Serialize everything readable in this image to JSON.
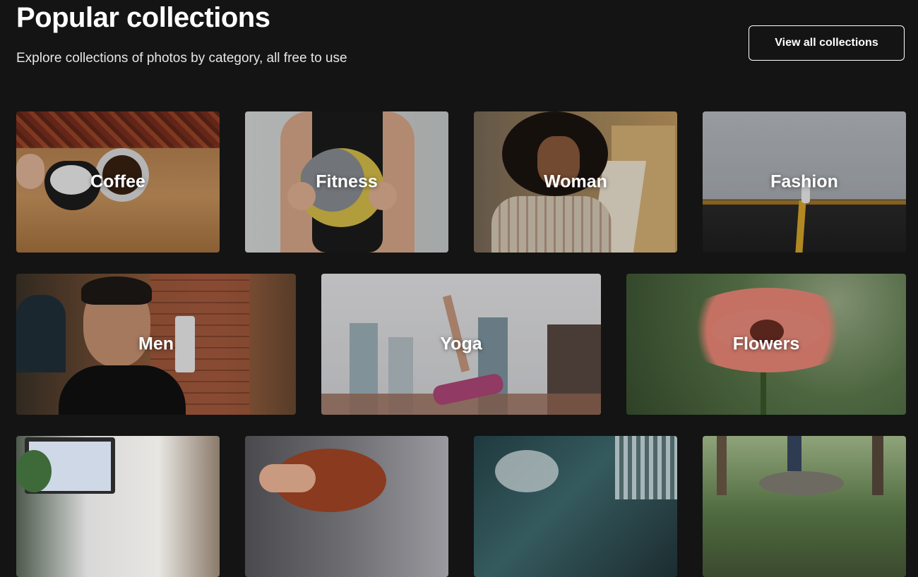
{
  "header": {
    "title": "Popular collections",
    "subtitle": "Explore collections of photos by category, all free to use",
    "view_all_label": "View all collections"
  },
  "collections": [
    {
      "label": "Coffee"
    },
    {
      "label": "Fitness"
    },
    {
      "label": "Woman"
    },
    {
      "label": "Fashion"
    },
    {
      "label": "Men"
    },
    {
      "label": "Yoga"
    },
    {
      "label": "Flowers"
    },
    {
      "label": ""
    },
    {
      "label": ""
    },
    {
      "label": ""
    },
    {
      "label": ""
    }
  ],
  "colors": {
    "background": "#141414",
    "text": "#ffffff"
  }
}
